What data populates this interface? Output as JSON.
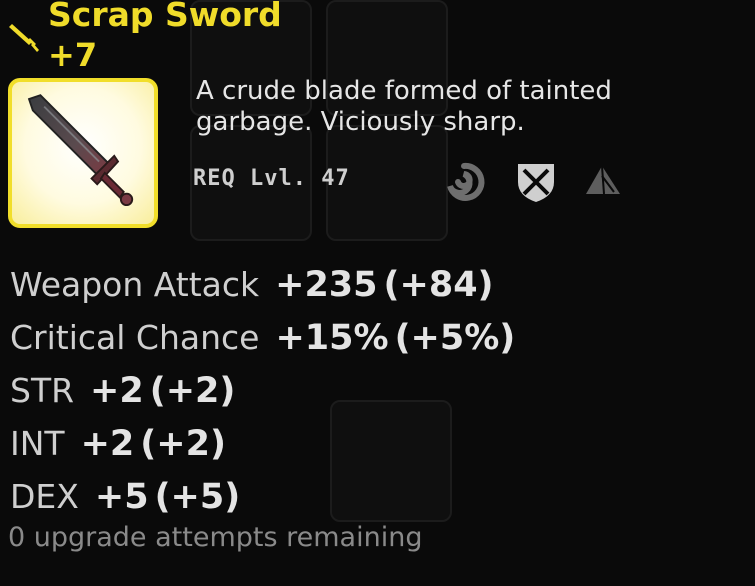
{
  "item": {
    "name": "Scrap Sword",
    "upgrade": "+7",
    "description": "A crude blade formed of tainted garbage. Viciously sharp.",
    "requirement": "REQ Lvl. 47",
    "class_icons": [
      "swirl-icon",
      "shield-cross-icon",
      "sail-icon"
    ],
    "image_icon": "sword-icon",
    "frame_color": "#f1de2a",
    "title_color": "#f0dc2a"
  },
  "stats": [
    {
      "name": "Weapon Attack",
      "value": "+235",
      "bonus": "(+84)"
    },
    {
      "name": "Critical Chance",
      "value": "+15%",
      "bonus": "(+5%)"
    },
    {
      "name": "STR",
      "value": "+2",
      "bonus": "(+2)"
    },
    {
      "name": "INT",
      "value": "+2",
      "bonus": "(+2)"
    },
    {
      "name": "DEX",
      "value": "+5",
      "bonus": "(+5)"
    }
  ],
  "attempts": "0 upgrade attempts remaining"
}
